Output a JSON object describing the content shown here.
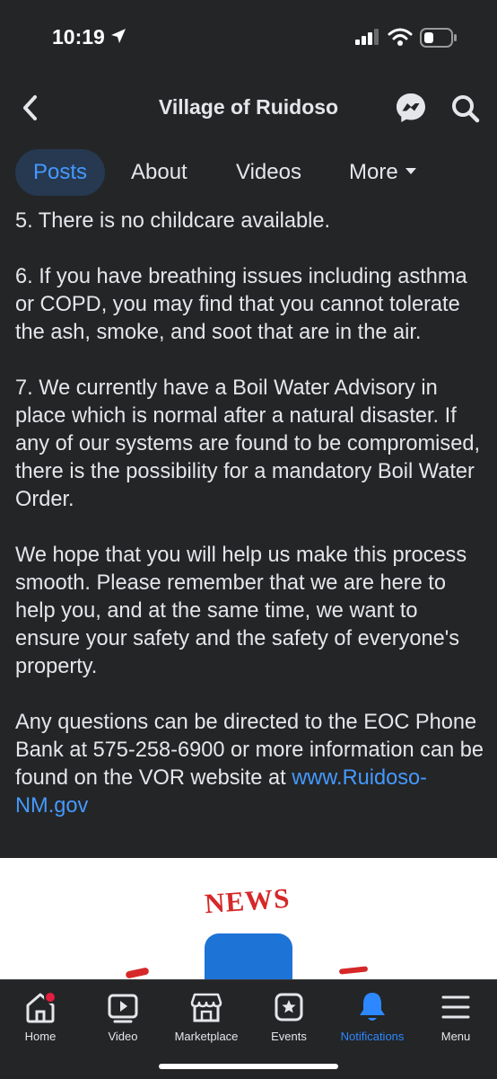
{
  "status_bar": {
    "time": "10:19"
  },
  "header": {
    "title": "Village of Ruidoso"
  },
  "tabs": [
    {
      "label": "Posts"
    },
    {
      "label": "About"
    },
    {
      "label": "Videos"
    },
    {
      "label": "More"
    }
  ],
  "post": {
    "paragraphs": [
      "5. There is no childcare available.",
      "6. If you have breathing issues including asthma or COPD, you may find that you cannot tolerate the ash, smoke, and soot that are in the air.",
      "7. We currently have a Boil Water Advisory in place which is normal after a natural disaster. If any of our systems are found to be compromised, there is the possibility for a mandatory Boil Water Order.",
      "We hope that you will help us make this process smooth. Please remember that we are here to help you, and at the same time, we want to ensure your safety and the safety of everyone's property."
    ],
    "last_paragraph_text": "Any questions can be directed to the EOC Phone Bank at 575-258-6900 or more information can be found on the VOR website at ",
    "link_text": "www.Ruidoso-NM.gov"
  },
  "image": {
    "logo_text": "NEWS"
  },
  "bottom_nav": [
    {
      "label": "Home",
      "icon": "home-icon",
      "badge": true
    },
    {
      "label": "Video",
      "icon": "video-icon"
    },
    {
      "label": "Marketplace",
      "icon": "marketplace-icon"
    },
    {
      "label": "Events",
      "icon": "events-icon"
    },
    {
      "label": "Notifications",
      "icon": "bell-icon",
      "active": true
    },
    {
      "label": "Menu",
      "icon": "menu-icon"
    }
  ],
  "colors": {
    "accent": "#4599ff",
    "background": "#242526",
    "badge": "#e41e3f"
  }
}
